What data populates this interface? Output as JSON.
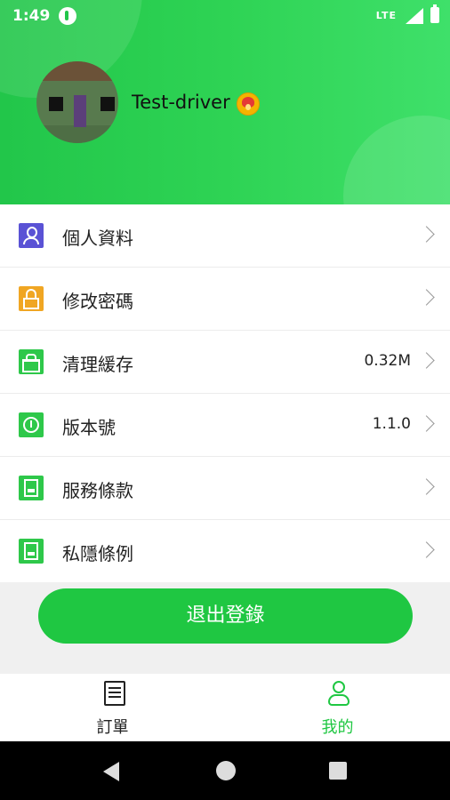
{
  "status_bar": {
    "time": "1:49",
    "network": "LTE"
  },
  "profile": {
    "username": "Test-driver"
  },
  "menu": [
    {
      "label": "個人資料",
      "value": "",
      "icon": "person-icon"
    },
    {
      "label": "修改密碼",
      "value": "",
      "icon": "lock-icon"
    },
    {
      "label": "清理緩存",
      "value": "0.32M",
      "icon": "basket-icon"
    },
    {
      "label": "版本號",
      "value": "1.1.0",
      "icon": "info-icon"
    },
    {
      "label": "服務條款",
      "value": "",
      "icon": "document-icon"
    },
    {
      "label": "私隱條例",
      "value": "",
      "icon": "document-icon"
    }
  ],
  "logout_label": "退出登錄",
  "bottom_nav": [
    {
      "label": "訂單",
      "icon": "orders-icon",
      "active": false
    },
    {
      "label": "我的",
      "icon": "profile-icon",
      "active": true
    }
  ],
  "colors": {
    "accent": "#1fc742",
    "header_start": "#22c64a",
    "header_end": "#3fe06a"
  }
}
